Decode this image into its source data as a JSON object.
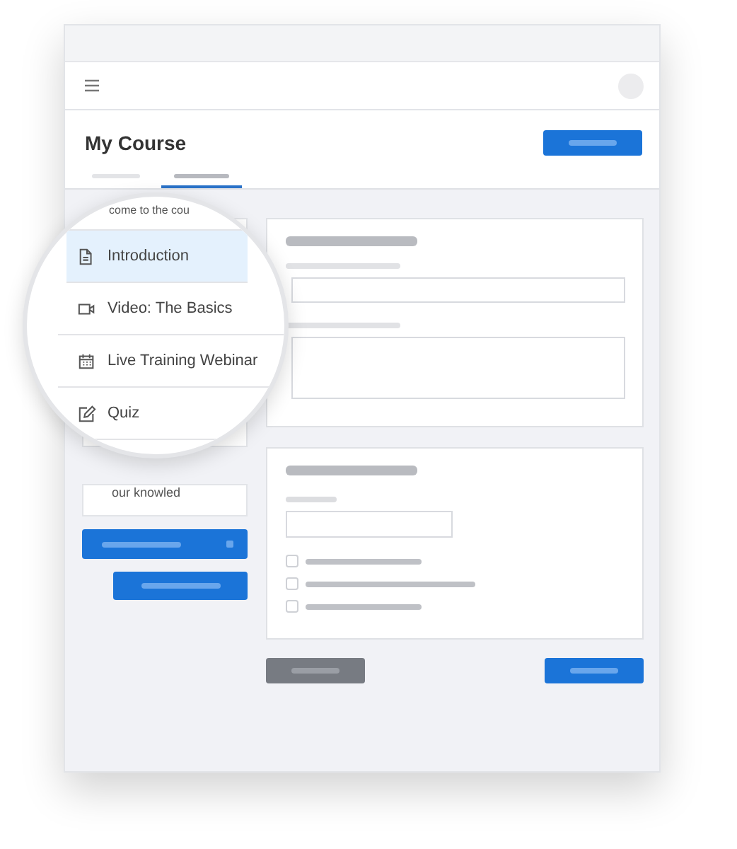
{
  "page": {
    "title": "My Course"
  },
  "tabs": [
    {
      "selected": false
    },
    {
      "selected": true
    }
  ],
  "sidebar": {
    "intro_text": "come to the cou",
    "footer_text": "our knowled"
  },
  "lessons": [
    {
      "label": "Introduction",
      "kind": "document",
      "selected": true
    },
    {
      "label": "Video: The Basics",
      "kind": "video",
      "selected": false
    },
    {
      "label": "Live Training Webinar",
      "kind": "calendar",
      "selected": false
    },
    {
      "label": "Quiz",
      "kind": "edit",
      "selected": false
    }
  ],
  "form_checkboxes": [
    {
      "checked": false
    },
    {
      "checked": false
    },
    {
      "checked": false
    }
  ]
}
